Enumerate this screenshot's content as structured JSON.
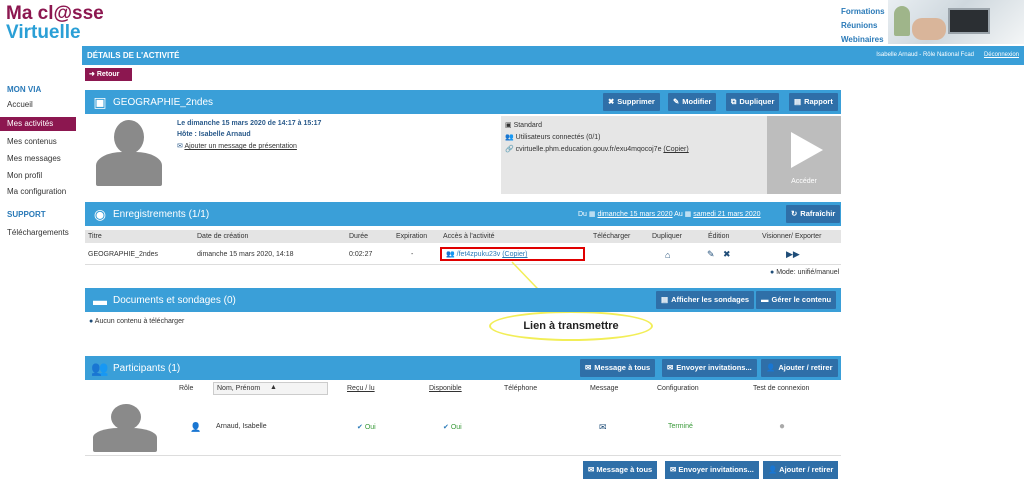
{
  "header": {
    "logo_line1": "Ma cl@sse",
    "logo_line2": "Virtuelle",
    "links": [
      "Formations",
      "Réunions",
      "Webinaires"
    ],
    "page_title": "DÉTAILS DE L'ACTIVITÉ",
    "user": "Isabelle Arnaud - Rôle National Fcad",
    "logout": "Déconnexion"
  },
  "sidebar": {
    "section1": "MON VIA",
    "items": [
      "Accueil",
      "Mes activités",
      "Mes contenus",
      "Mes messages",
      "Mon profil",
      "Ma configuration"
    ],
    "section2": "SUPPORT",
    "support_items": [
      "Téléchargements"
    ]
  },
  "retour_label": "Retour",
  "activity": {
    "title": "GEOGRAPHIE_2ndes",
    "buttons": [
      "Supprimer",
      "Modifier",
      "Dupliquer",
      "Rapport"
    ],
    "date": "Le dimanche 15 mars 2020 de 14:17 à 15:17",
    "host": "Hôte : Isabelle Arnaud",
    "add_message": "Ajouter un message de présentation",
    "type": "Standard",
    "connected": "Utilisateurs connectés (0/1)",
    "url": "cvirtuelle.phm.education.gouv.fr/exu4mqocoj7e",
    "copy": "(Copier)",
    "access": "Accéder"
  },
  "recordings": {
    "title": "Enregistrements (1/1)",
    "from": "Du",
    "date_from": "dimanche 15 mars 2020",
    "to": "Au",
    "date_to": "samedi 21 mars 2020",
    "refresh": "Rafraîchir",
    "columns": [
      "Titre",
      "Date de création",
      "Durée",
      "Expiration",
      "Accès à l'activité",
      "Télécharger",
      "Dupliquer",
      "Édition",
      "Visionner/ Exporter"
    ],
    "row": {
      "title": "GEOGRAPHIE_2ndes",
      "created": "dimanche 15 mars 2020, 14:18",
      "duration": "0:02:27",
      "expiration": "-",
      "access_link": "/fet4zpuku23v",
      "copy": "(Copier)"
    },
    "mode": "Mode: unifié/manuel"
  },
  "annotation": "Lien à transmettre",
  "documents": {
    "title": "Documents et sondages (0)",
    "btn_polls": "Afficher les sondages",
    "btn_manage": "Gérer le contenu",
    "empty": "Aucun contenu à télécharger"
  },
  "participants": {
    "title": "Participants (1)",
    "btn_message": "Message à tous",
    "btn_invite": "Envoyer invitations...",
    "btn_add": "Ajouter / retirer",
    "columns": [
      "Rôle",
      "Nom, Prénom",
      "Reçu / lu",
      "Disponible",
      "Téléphone",
      "Message",
      "Configuration",
      "Test de connexion"
    ],
    "row": {
      "name": "Arnaud, Isabelle",
      "received": "Oui",
      "available": "Oui",
      "configuration": "Terminé"
    }
  }
}
